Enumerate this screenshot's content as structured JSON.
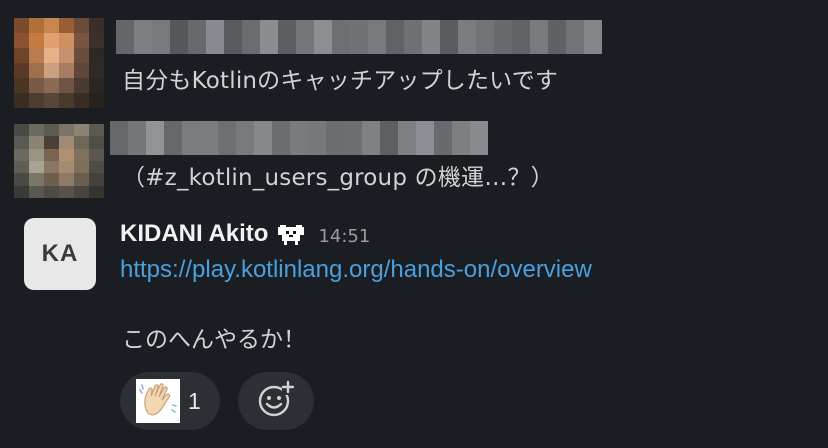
{
  "messages": [
    {
      "author_avatar": "pixelated-photo",
      "author_name": "",
      "text": "自分もKotlinのキャッチアップしたいです"
    },
    {
      "author_avatar": "pixelated-photo",
      "author_name": "",
      "text": "（#z_kotlin_users_group の機運…？）"
    },
    {
      "author_avatar_initials": "KA",
      "author_name": "KIDANI Akito",
      "status_icon": "dog-emoji-icon",
      "timestamp": "14:51",
      "link": "https://play.kotlinlang.org/hands-on/overview",
      "text": "このへんやるか！"
    }
  ],
  "reactions": [
    {
      "emoji": "waving-hand-icon",
      "count": "1"
    }
  ],
  "add_reaction_icon": "add-emoji-icon",
  "colors": {
    "background": "#1a1d21",
    "text": "#d1d2d3",
    "link": "#4a9fde",
    "timestamp": "#9a9b9d",
    "pill": "#2c2f33"
  }
}
